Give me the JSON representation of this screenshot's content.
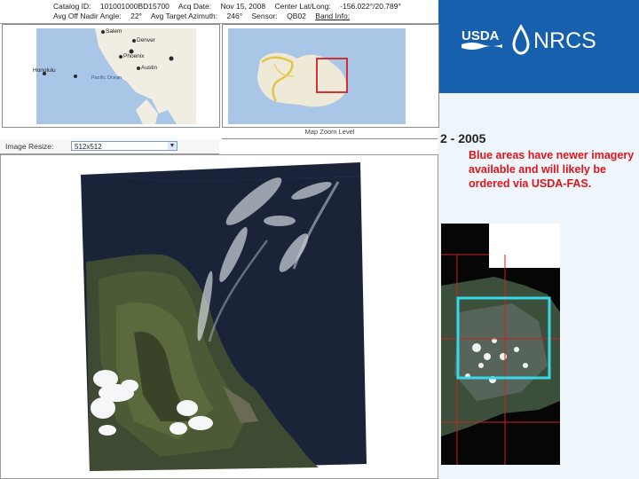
{
  "info_bar": {
    "row1": {
      "catalog_id_label": "Catalog ID:",
      "catalog_id": "101001000BD15700",
      "acq_date_label": "Acq Date:",
      "acq_date": "Nov 15, 2008",
      "center_label": "Center Lat/Long:",
      "center_value": "-156.022°/20.789°"
    },
    "row2": {
      "nadir_label": "Avg Off Nadir Angle:",
      "nadir_value": "22°",
      "azimuth_label": "Avg Target Azimuth:",
      "azimuth_value": "246°",
      "sensor_label": "Sensor:",
      "sensor_value": "QB02",
      "band_label": "Band Info:"
    }
  },
  "overview_map": {
    "cities": [
      "Salem",
      "Denver",
      "Phoenix",
      "Austin",
      "Honolulu"
    ],
    "ocean_label": "Pacific Ocean"
  },
  "zoom_map": {
    "caption": "Map Zoom Level"
  },
  "image_resize": {
    "label": "Image Resize:",
    "value": "512x512"
  },
  "slide": {
    "org_usda": "USDA",
    "org_nrcs": "NRCS",
    "year_range": "2 - 2005",
    "note": "Blue areas have newer imagery available and will likely be ordered via USDA-FAS."
  },
  "colors": {
    "header_blue": "#1660ad",
    "note_red": "#e0141b",
    "highlight_cyan": "#38d8e8",
    "grid_red": "#d02020"
  }
}
